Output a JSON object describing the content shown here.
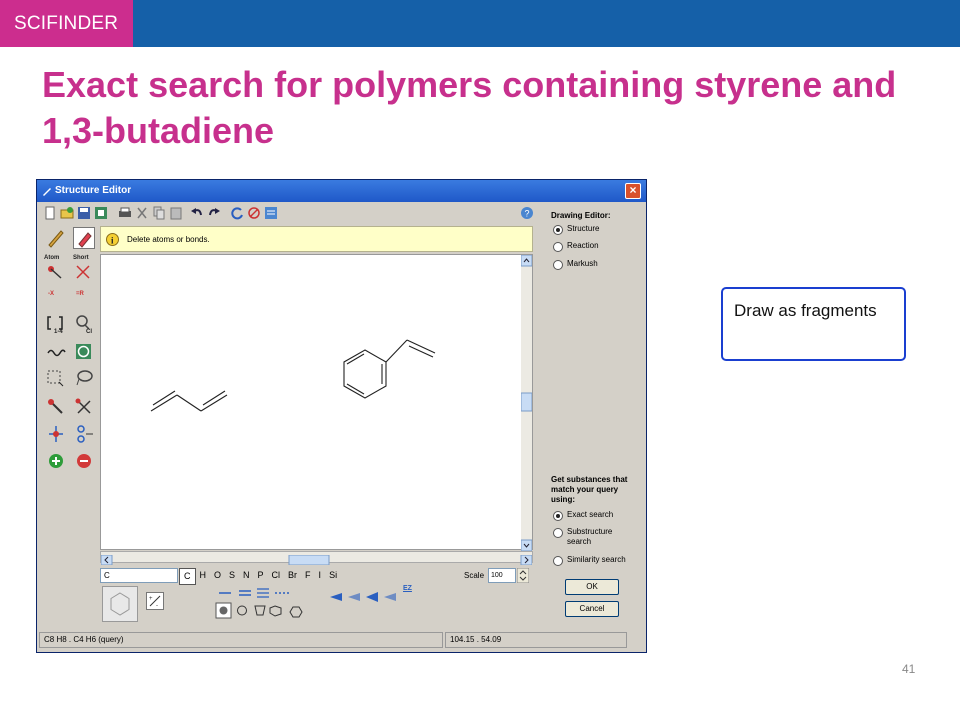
{
  "brand": "SCIFINDER",
  "title": "Exact search for polymers containing styrene and 1,3-butadiene",
  "callout": "Draw as fragments",
  "page_number": "41",
  "window": {
    "title": "Structure Editor",
    "close": "×",
    "hint": "Delete atoms or bonds.",
    "left_labels": [
      "Atom",
      "Short",
      "-X",
      "=R",
      "1-4",
      "Cl"
    ],
    "element_input": "C",
    "elements": [
      "C",
      "H",
      "O",
      "S",
      "N",
      "P",
      "Cl",
      "Br",
      "F",
      "I",
      "Si"
    ],
    "scale_label": "Scale",
    "scale_value": "100",
    "ez_label": "EZ",
    "right": {
      "drawing_editor_label": "Drawing Editor:",
      "drawing_modes": [
        "Structure",
        "Reaction",
        "Markush"
      ],
      "get_substances_label": "Get substances that match your query using:",
      "search_types": [
        "Exact search",
        "Substructure search",
        "Similarity search"
      ],
      "ok": "OK",
      "cancel": "Cancel"
    },
    "status_formula": "C8 H8 . C4 H6 (query)",
    "status_coords": "104.15 . 54.09"
  }
}
